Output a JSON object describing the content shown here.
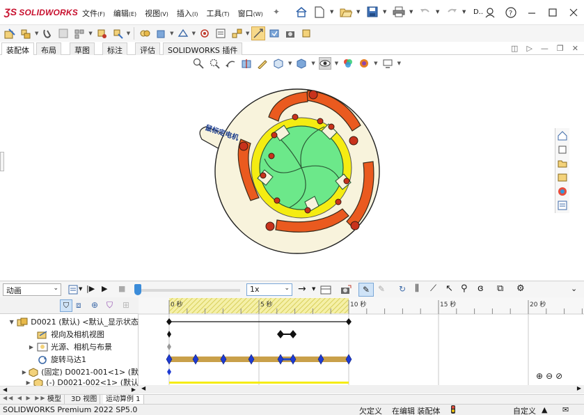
{
  "app": {
    "logo_text": "SOLIDWORKS",
    "menu": [
      {
        "label": "文件",
        "key": "(F)"
      },
      {
        "label": "编辑",
        "key": "(E)"
      },
      {
        "label": "视图",
        "key": "(V)"
      },
      {
        "label": "插入",
        "key": "(I)"
      },
      {
        "label": "工具",
        "key": "(T)"
      },
      {
        "label": "窗口",
        "key": "(W)"
      }
    ],
    "search_stub": "D..",
    "icons": {
      "quick_access": [
        "home-icon",
        "new-document-icon",
        "open-folder-icon",
        "save-icon",
        "print-icon",
        "undo-icon",
        "redo-icon"
      ],
      "window": [
        "help-icon",
        "minimize-icon",
        "maximize-icon",
        "close-icon"
      ]
    }
  },
  "command_tabs": [
    "装配体",
    "布局",
    "草图",
    "标注",
    "评估",
    "SOLIDWORKS 插件"
  ],
  "active_command_tab": 0,
  "graphics": {
    "model_label": "鼠标定电机",
    "colors": {
      "base_plate": "#f8f3dc",
      "disc": "#6ce88a",
      "yellow_ring": "#f5ec12",
      "arms": "#ea5a1f",
      "pins": "#c8321c"
    }
  },
  "motion_manager": {
    "study_type": "动画",
    "playback_speed": "1x",
    "playback_position": 0,
    "time_ticks": [
      "0 秒",
      "5 秒",
      "10 秒",
      "15 秒",
      "20 秒"
    ],
    "tree": [
      {
        "label": "D0021 (默认) <默认_显示状态",
        "expand": "▼",
        "icon": "assembly-icon"
      },
      {
        "label": "视向及相机视图",
        "expand": "",
        "icon": "camera-view-icon"
      },
      {
        "label": "光源、相机与布景",
        "expand": "▶",
        "icon": "lights-icon"
      },
      {
        "label": "旋转马达1",
        "expand": "",
        "icon": "rotary-motor-icon"
      },
      {
        "label": "(固定) D0021-001<1> (默",
        "expand": "▶",
        "icon": "part-icon"
      },
      {
        "label": "(-) D0021-002<1> (默认",
        "expand": "▶",
        "icon": "part-icon"
      }
    ]
  },
  "bottom_tabs": [
    "模型",
    "3D 视图",
    "运动算例 1"
  ],
  "active_bottom_tab": 2,
  "status": {
    "product": "SOLIDWORKS Premium 2022 SP5.0",
    "definition": "欠定义",
    "editing": "在编辑 装配体",
    "units": "自定义"
  }
}
